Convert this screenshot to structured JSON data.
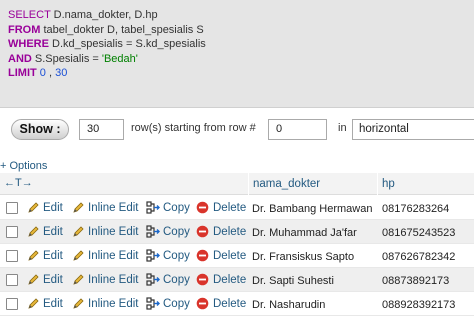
{
  "sql": {
    "line1": {
      "kw": "SELECT",
      "rest": " D.nama_dokter, D.hp"
    },
    "line2": {
      "kw": "FROM",
      "rest": " tabel_dokter D, tabel_spesialis S"
    },
    "line3": {
      "kw": "WHERE",
      "rest1": " D.kd_spesialis ",
      "op": "=",
      "rest2": " S.kd_spesialis"
    },
    "line4": {
      "kw": "AND",
      "rest1": " S.Spesialis ",
      "op": "=",
      "str": " 'Bedah'"
    },
    "line5": {
      "kw": "LIMIT",
      "n1": " 0",
      "sep": " ,",
      "n2": " 30"
    }
  },
  "nav": {
    "show_label": "Show :",
    "rows_value": "30",
    "rows_text": "row(s) starting from row #",
    "start_value": "0",
    "in_text": "in",
    "mode_value": "horizontal"
  },
  "options_label": "+ Options",
  "sort_arrows": "←T→",
  "columns": [
    "nama_dokter",
    "hp"
  ],
  "actions": {
    "edit": "Edit",
    "inline_edit": "Inline Edit",
    "copy": "Copy",
    "delete": "Delete"
  },
  "rows": [
    {
      "nama": "Dr. Bambang Hermawan",
      "hp": "08176283264"
    },
    {
      "nama": "Dr. Muhammad Ja'far",
      "hp": "081675243523"
    },
    {
      "nama": "Dr. Fransiskus Sapto",
      "hp": "087626782342"
    },
    {
      "nama": "Dr. Sapti Suhesti",
      "hp": "08873892173"
    },
    {
      "nama": "Dr. Nasharudin",
      "hp": "088928392173"
    }
  ],
  "colors": {
    "sql_keyword": "#990099",
    "sql_string": "#008000",
    "sql_number": "#1a4fd6",
    "link": "#235a81",
    "delete_icon": "#d9342b"
  }
}
